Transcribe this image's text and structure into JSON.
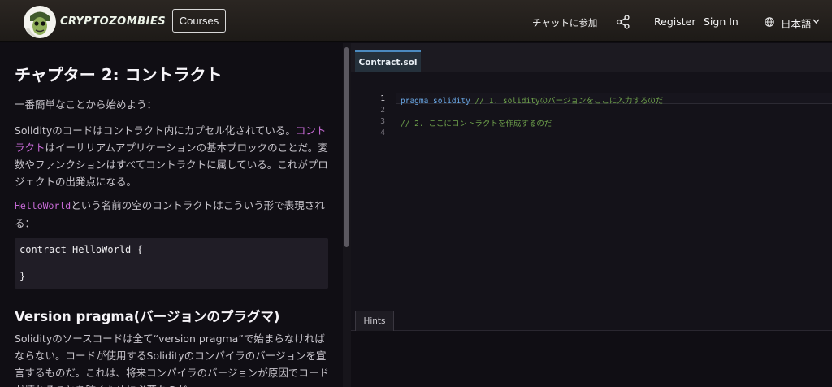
{
  "header": {
    "logo_text": "CRYPTOZOMBIES",
    "courses_label": "Courses",
    "chat_label": "チャットに参加",
    "share_icon": "share-icon",
    "register_label": "Register",
    "signin_label": "Sign In",
    "language_icon": "globe-icon",
    "language_label": "日本語"
  },
  "lesson": {
    "title": "チャプター 2: コントラクト",
    "intro": "一番簡単なことから始めよう：",
    "p2_a": "Solidityのコードはコントラクト内にカプセル化されている。",
    "p2_link": "コントラクト",
    "p2_b": "はイーサリアムアプリケーションの基本ブロックのことだ。変数やファンクションはすべてコントラクトに属している。これがプロジェクトの出発点になる。",
    "p3_code": "HelloWorld",
    "p3_text": "という名前の空のコントラクトはこういう形で表現される：",
    "code_line1": "contract HelloWorld {",
    "code_line2": "}",
    "section_title": "Version pragma(バージョンのプラグマ)",
    "p4": "Solidityのソースコードは全て“version pragma”で始まらなければならない。コードが使用するSolidityのコンパイラのバージョンを宣言するものだ。これは、将来コンパイラのバージョンが原因でコードが壊れることを防ぐために必要なのだ。"
  },
  "editor": {
    "tab_label": "Contract.sol",
    "line_numbers": [
      "1",
      "2",
      "3",
      "4"
    ],
    "line1_keyword": "pragma solidity",
    "line1_comment": "// 1. solidityのバージョンをここに入力するのだ",
    "line3_comment": "// 2. ここにコントラクトを作成するのだ",
    "hints_label": "Hints"
  },
  "colors": {
    "accent_link": "#c96bd8",
    "keyword": "#6aa9e8",
    "comment": "#6fa24c"
  }
}
